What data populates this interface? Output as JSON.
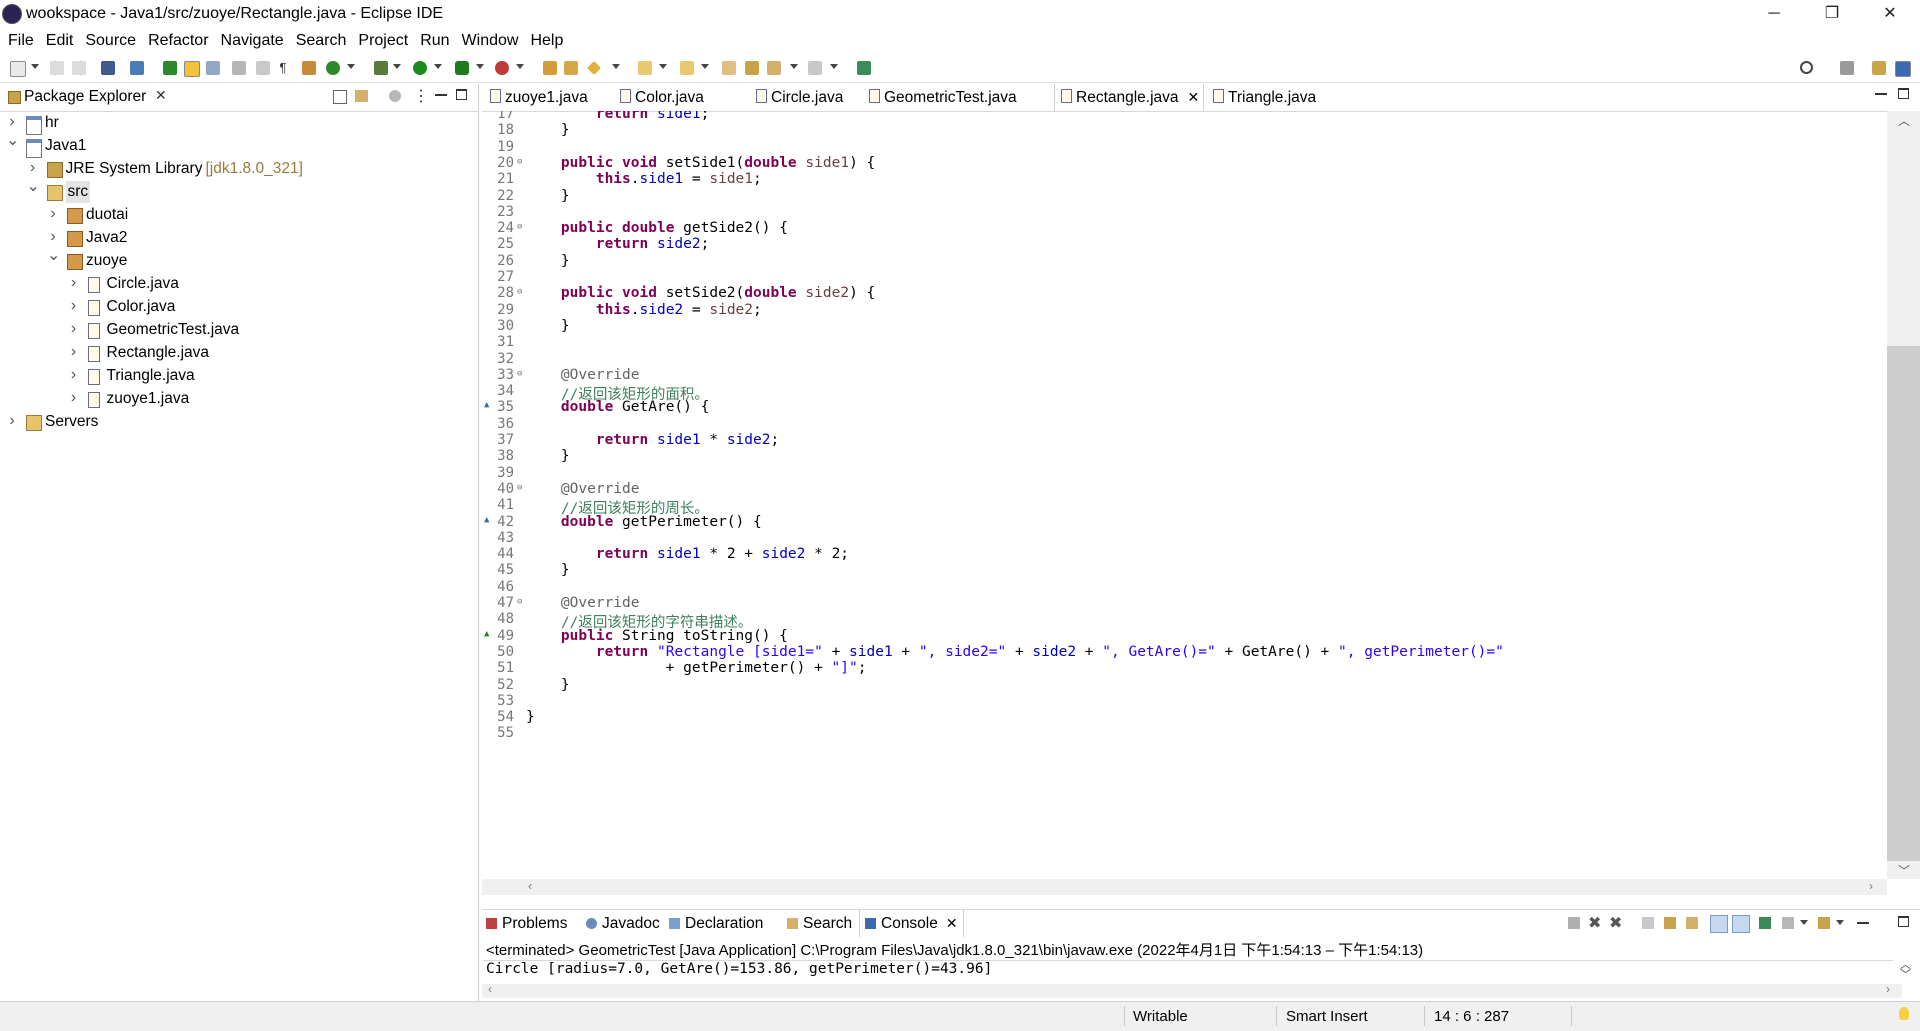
{
  "window": {
    "title": "wookspace - Java1/src/zuoye/Rectangle.java - Eclipse IDE",
    "minimize": "─",
    "restore": "❐",
    "close": "✕"
  },
  "menu": [
    "File",
    "Edit",
    "Source",
    "Refactor",
    "Navigate",
    "Search",
    "Project",
    "Run",
    "Window",
    "Help"
  ],
  "package_explorer": {
    "title": "Package Explorer",
    "tree": [
      {
        "label": "hr",
        "twisty": ">",
        "icon": "project-icon"
      },
      {
        "label": "Java1",
        "twisty": "v",
        "icon": "project-icon"
      },
      {
        "label": "JRE System Library",
        "decoration": "[jdk1.8.0_321]",
        "twisty": ">",
        "icon": "library-icon"
      },
      {
        "label": "src",
        "twisty": "v",
        "icon": "source-folder-icon"
      },
      {
        "label": "duotai",
        "twisty": ">",
        "icon": "package-icon"
      },
      {
        "label": "Java2",
        "twisty": ">",
        "icon": "package-icon"
      },
      {
        "label": "zuoye",
        "twisty": "v",
        "icon": "package-icon"
      },
      {
        "label": "Circle.java",
        "twisty": ">",
        "icon": "java-file-icon"
      },
      {
        "label": "Color.java",
        "twisty": ">",
        "icon": "java-file-icon"
      },
      {
        "label": "GeometricTest.java",
        "twisty": ">",
        "icon": "java-file-icon"
      },
      {
        "label": "Rectangle.java",
        "twisty": ">",
        "icon": "java-file-icon"
      },
      {
        "label": "Triangle.java",
        "twisty": ">",
        "icon": "java-file-icon"
      },
      {
        "label": "zuoye1.java",
        "twisty": ">",
        "icon": "java-file-icon"
      },
      {
        "label": "Servers",
        "twisty": ">",
        "icon": "folder-icon"
      }
    ]
  },
  "editor": {
    "tabs": [
      "zuoye1.java",
      "Color.java",
      "Circle.java",
      "GeometricTest.java",
      "Rectangle.java",
      "Triangle.java"
    ],
    "active_tab": "Rectangle.java",
    "line_numbers": [
      "17",
      "18",
      "19",
      "20",
      "21",
      "22",
      "23",
      "24",
      "25",
      "26",
      "27",
      "28",
      "29",
      "30",
      "31",
      "32",
      "33",
      "34",
      "35",
      "36",
      "37",
      "38",
      "39",
      "40",
      "41",
      "42",
      "43",
      "44",
      "45",
      "46",
      "47",
      "48",
      "49",
      "50",
      "51",
      "52",
      "53",
      "54",
      "55"
    ],
    "fold_lines": [
      "20",
      "24",
      "28",
      "33",
      "40",
      "47"
    ],
    "override_lines": [
      "35",
      "42",
      "49"
    ]
  },
  "console": {
    "tabs": [
      "Problems",
      "Javadoc",
      "Declaration",
      "Search",
      "Console"
    ],
    "status_line": "<terminated> GeometricTest [Java Application] C:\\Program Files\\Java\\jdk1.8.0_321\\bin\\javaw.exe  (2022年4月1日 下午1:54:13 – 下午1:54:13)",
    "output": "Circle [radius=7.0, GetAre()=153.86, getPerimeter()=43.96]"
  },
  "status_bar": {
    "writable": "Writable",
    "insert_mode": "Smart Insert",
    "position": "14 : 6 : 287"
  },
  "colors": {
    "keyword": "#7f0055",
    "field": "#0000c0",
    "comment": "#3f7f5f",
    "string": "#2a00ff",
    "annotation": "#646464"
  }
}
